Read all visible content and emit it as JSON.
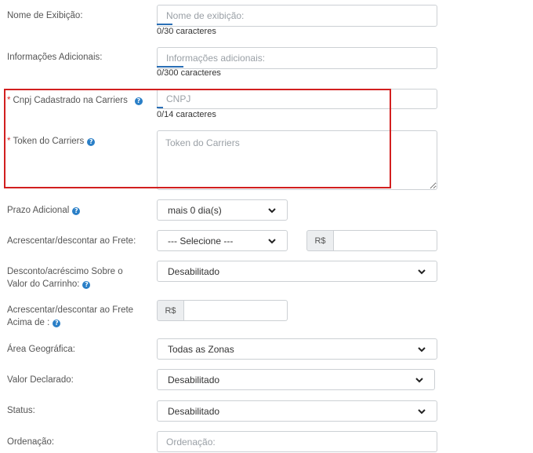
{
  "fields": {
    "display_name": {
      "label": "Nome de Exibição:",
      "placeholder": "Nome de exibição:",
      "counter": "0/30 caracteres"
    },
    "additional_info": {
      "label": "Informações Adicionais:",
      "placeholder": "Informações adicionais:",
      "counter": "0/300 caracteres"
    },
    "cnpj": {
      "required_mark": "*",
      "label": "Cnpj Cadastrado na Carriers",
      "placeholder": "CNPJ",
      "counter": "0/14 caracteres"
    },
    "token": {
      "required_mark": "*",
      "label": "Token do Carriers",
      "placeholder": "Token do Carriers"
    },
    "prazo": {
      "label": "Prazo Adicional",
      "value": "mais 0 dia(s)"
    },
    "frete": {
      "label": "Acrescentar/descontar ao Frete:",
      "value": "--- Selecione ---",
      "currency": "R$"
    },
    "desconto_carrinho": {
      "label_line1": "Desconto/acréscimo Sobre o",
      "label_line2": "Valor do Carrinho:",
      "value": "Desabilitado"
    },
    "frete_acima": {
      "label_line1": "Acrescentar/descontar ao Frete",
      "label_line2": "Acima de :",
      "currency": "R$"
    },
    "area": {
      "label": "Área Geográfica:",
      "value": "Todas as Zonas"
    },
    "valor_declarado": {
      "label": "Valor Declarado:",
      "value": "Desabilitado"
    },
    "status": {
      "label": "Status:",
      "value": "Desabilitado"
    },
    "ordenacao": {
      "label": "Ordenação:",
      "placeholder": "Ordenação:"
    }
  },
  "help_glyph": "?",
  "colors": {
    "highlight": "#d21f1f",
    "help": "#2a7fc7",
    "required": "#d9302c"
  }
}
